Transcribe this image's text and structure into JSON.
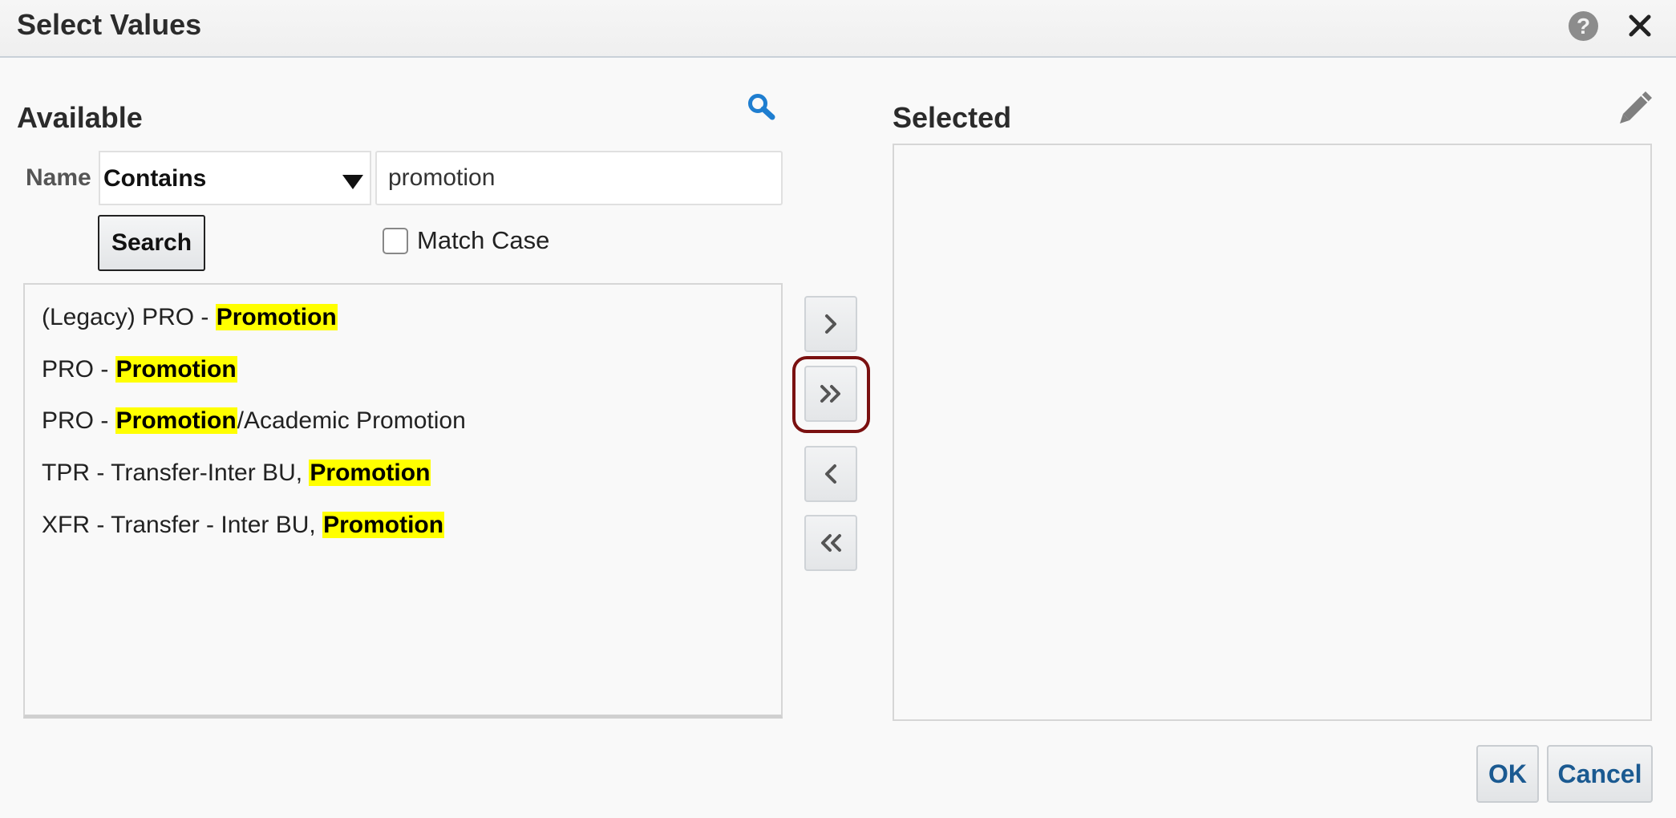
{
  "dialog": {
    "title": "Select Values",
    "help_icon": "help-icon",
    "close_icon": "close-icon"
  },
  "available": {
    "heading": "Available",
    "search_icon": "search-icon",
    "filter": {
      "field_label": "Name",
      "operator_selected": "Contains",
      "query_value": "promotion",
      "query_placeholder": ""
    },
    "search_button_label": "Search",
    "match_case": {
      "label": "Match Case",
      "checked": false
    },
    "items": [
      {
        "prefix": "(Legacy) PRO - ",
        "match": "Promotion",
        "suffix": ""
      },
      {
        "prefix": "PRO - ",
        "match": "Promotion",
        "suffix": ""
      },
      {
        "prefix": "PRO - ",
        "match": "Promotion",
        "suffix": "/Academic Promotion"
      },
      {
        "prefix": "TPR - Transfer-Inter BU, ",
        "match": "Promotion",
        "suffix": ""
      },
      {
        "prefix": "XFR - Transfer - Inter BU, ",
        "match": "Promotion",
        "suffix": ""
      }
    ],
    "highlight_color": "#ffff00"
  },
  "shuttle": {
    "move": {
      "icon": "chevron-right-icon",
      "label": "Move"
    },
    "move_all": {
      "icon": "double-chevron-right-icon",
      "label": "Move All",
      "focused": true
    },
    "remove": {
      "icon": "chevron-left-icon",
      "label": "Remove"
    },
    "remove_all": {
      "icon": "double-chevron-left-icon",
      "label": "Remove All"
    }
  },
  "selected": {
    "heading": "Selected",
    "edit_icon": "pencil-icon",
    "items": []
  },
  "footer": {
    "ok_label": "OK",
    "cancel_label": "Cancel"
  },
  "colors": {
    "button_text": "#1b5a91",
    "focus_ring": "#7a1010",
    "search_icon": "#1f7ed0"
  }
}
